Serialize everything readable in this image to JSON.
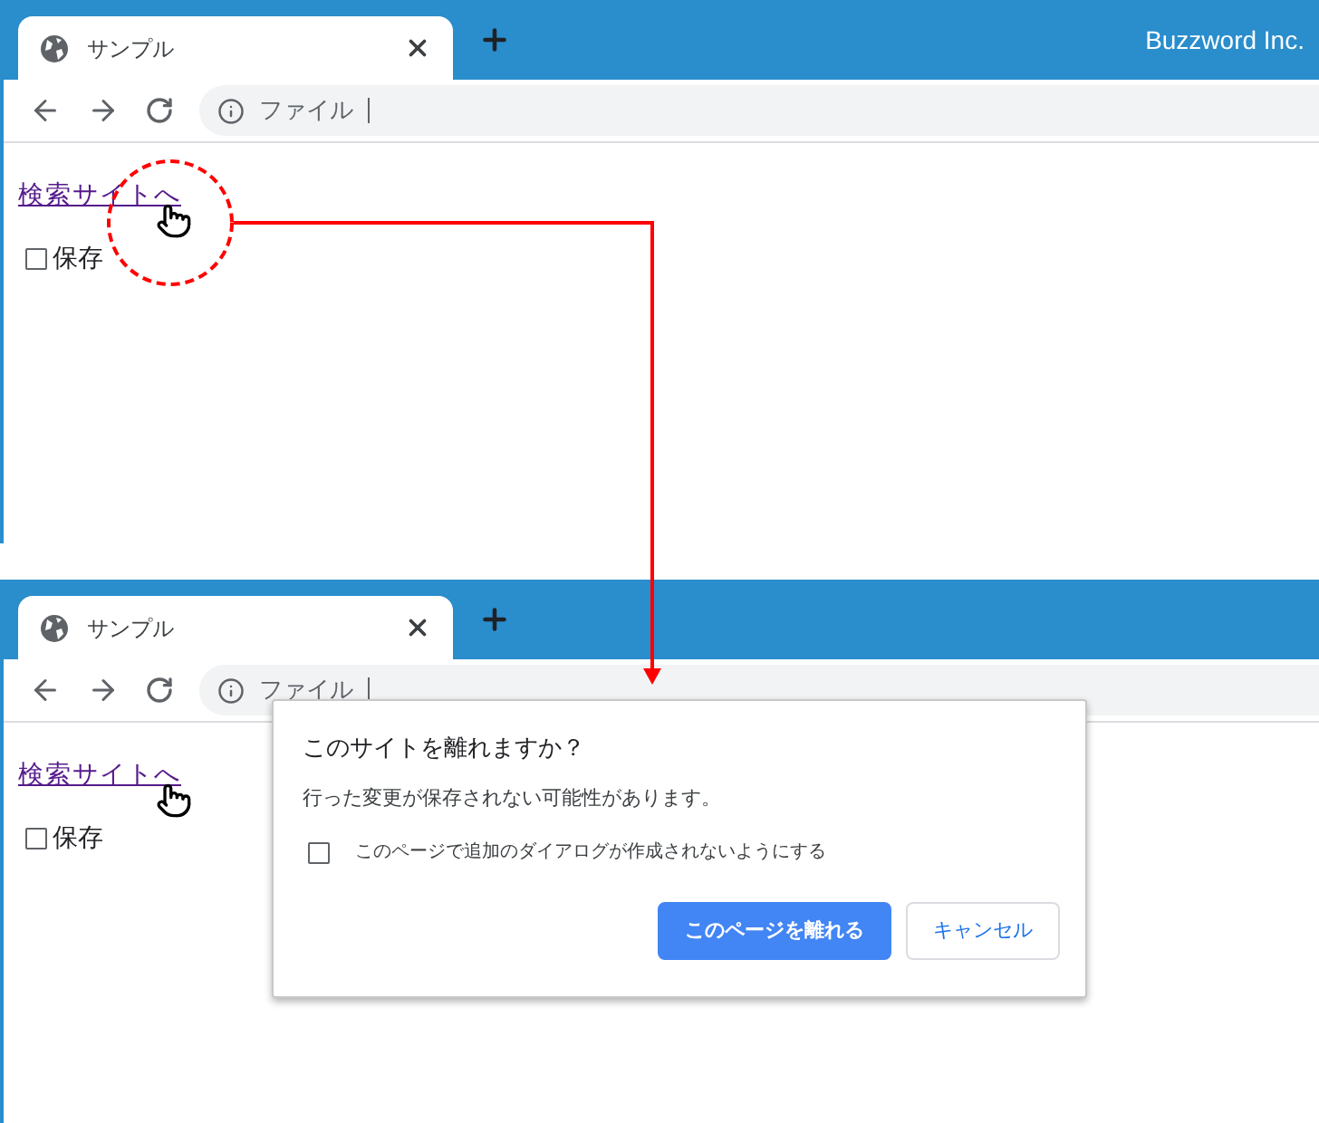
{
  "windows": [
    {
      "tab": {
        "title": "サンプル"
      },
      "brand": "Buzzword Inc.",
      "address": {
        "text": "ファイル"
      },
      "link": "検索サイトへ",
      "checkbox": {
        "label": "保存",
        "checked": false
      }
    },
    {
      "tab": {
        "title": "サンプル"
      },
      "address": {
        "text": "ファイル"
      },
      "link": "検索サイトへ",
      "checkbox": {
        "label": "保存",
        "checked": false
      },
      "dialog": {
        "title": "このサイトを離れますか？",
        "message": "行った変更が保存されない可能性があります。",
        "checkbox": {
          "label": "このページで追加のダイアログが作成されないようにする",
          "checked": false
        },
        "buttons": [
          {
            "label": "このページを離れる",
            "kind": "primary"
          },
          {
            "label": "キャンセル",
            "kind": "secondary"
          }
        ]
      }
    }
  ]
}
